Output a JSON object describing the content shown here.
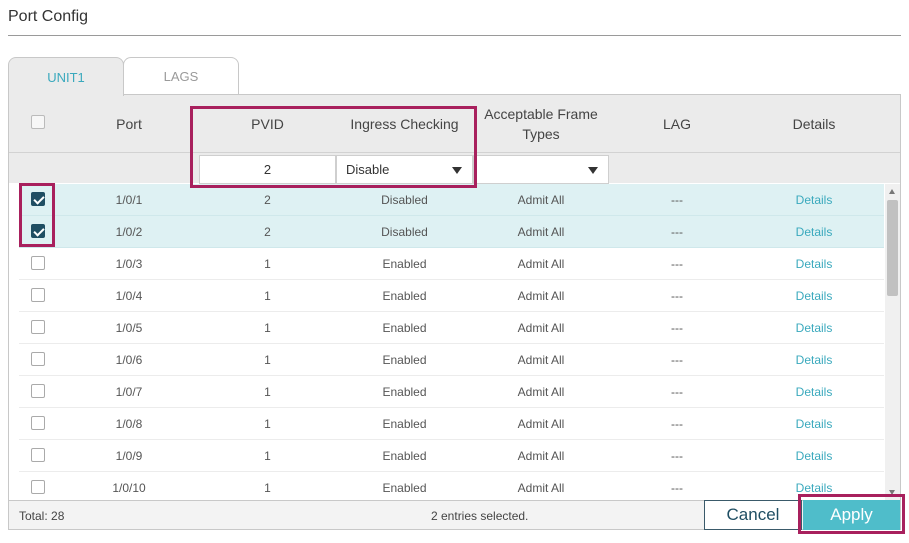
{
  "page": {
    "title": "Port Config"
  },
  "tabs": [
    {
      "label": "UNIT1"
    },
    {
      "label": "LAGS"
    }
  ],
  "columns": {
    "port": "Port",
    "pvid": "PVID",
    "ingress": "Ingress Checking",
    "aft_line1": "Acceptable Frame",
    "aft_line2": "Types",
    "lag": "LAG",
    "details": "Details"
  },
  "filter": {
    "pvid_value": "2",
    "ingress_value": "Disable",
    "aft_value": ""
  },
  "rows": [
    {
      "port": "1/0/1",
      "pvid": "2",
      "ingress": "Disabled",
      "aft": "Admit All",
      "lag": "---",
      "details": "Details"
    },
    {
      "port": "1/0/2",
      "pvid": "2",
      "ingress": "Disabled",
      "aft": "Admit All",
      "lag": "---",
      "details": "Details"
    },
    {
      "port": "1/0/3",
      "pvid": "1",
      "ingress": "Enabled",
      "aft": "Admit All",
      "lag": "---",
      "details": "Details"
    },
    {
      "port": "1/0/4",
      "pvid": "1",
      "ingress": "Enabled",
      "aft": "Admit All",
      "lag": "---",
      "details": "Details"
    },
    {
      "port": "1/0/5",
      "pvid": "1",
      "ingress": "Enabled",
      "aft": "Admit All",
      "lag": "---",
      "details": "Details"
    },
    {
      "port": "1/0/6",
      "pvid": "1",
      "ingress": "Enabled",
      "aft": "Admit All",
      "lag": "---",
      "details": "Details"
    },
    {
      "port": "1/0/7",
      "pvid": "1",
      "ingress": "Enabled",
      "aft": "Admit All",
      "lag": "---",
      "details": "Details"
    },
    {
      "port": "1/0/8",
      "pvid": "1",
      "ingress": "Enabled",
      "aft": "Admit All",
      "lag": "---",
      "details": "Details"
    },
    {
      "port": "1/0/9",
      "pvid": "1",
      "ingress": "Enabled",
      "aft": "Admit All",
      "lag": "---",
      "details": "Details"
    },
    {
      "port": "1/0/10",
      "pvid": "1",
      "ingress": "Enabled",
      "aft": "Admit All",
      "lag": "---",
      "details": "Details"
    }
  ],
  "footer": {
    "total": "Total: 28",
    "selected": "2 entries selected."
  },
  "buttons": {
    "cancel": "Cancel",
    "apply": "Apply"
  },
  "colors": {
    "accent": "#4fbdca",
    "highlight": "#a8205d",
    "selected_row": "#def1f3",
    "checkbox_checked": "#1f4e63"
  }
}
